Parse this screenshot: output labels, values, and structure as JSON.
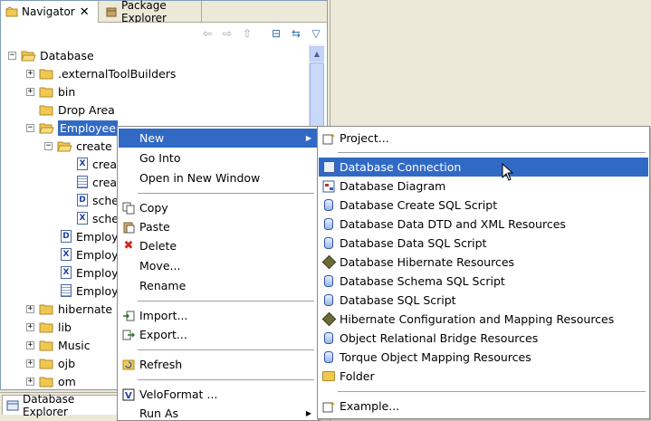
{
  "tabs": {
    "navigator": "Navigator",
    "package_explorer": "Package Explorer",
    "database_explorer": "Database Explorer"
  },
  "tree": {
    "root": "Database",
    "items": [
      ".externalToolBuilders",
      "bin",
      "Drop Area",
      "Employee",
      "create",
      "crea",
      "crea",
      "sche",
      "sche",
      "Employ",
      "Employ",
      "Employ",
      "Employ",
      "hibernate",
      "lib",
      "Music",
      "ojb",
      "om"
    ]
  },
  "context_menu": {
    "items": [
      {
        "label": "New",
        "submenu": true
      },
      {
        "label": "Go Into"
      },
      {
        "label": "Open in New Window"
      },
      {
        "label": "Copy"
      },
      {
        "label": "Paste"
      },
      {
        "label": "Delete"
      },
      {
        "label": "Move..."
      },
      {
        "label": "Rename"
      },
      {
        "label": "Import..."
      },
      {
        "label": "Export..."
      },
      {
        "label": "Refresh"
      },
      {
        "label": "VeloFormat ..."
      },
      {
        "label": "Run As",
        "submenu": true
      }
    ]
  },
  "new_submenu": {
    "items": [
      "Project...",
      "Database Connection",
      "Database Diagram",
      "Database Create SQL Script",
      "Database Data DTD and XML Resources",
      "Database Data SQL Script",
      "Database Hibernate Resources",
      "Database Schema SQL Script",
      "Database SQL Script",
      "Hibernate Configuration and Mapping Resources",
      "Object Relational Bridge Resources",
      "Torque Object Mapping Resources",
      "Folder",
      "Example..."
    ]
  },
  "colors": {
    "selection": "#316ac5",
    "folder": "#f0c850",
    "background": "#ece9d8"
  }
}
